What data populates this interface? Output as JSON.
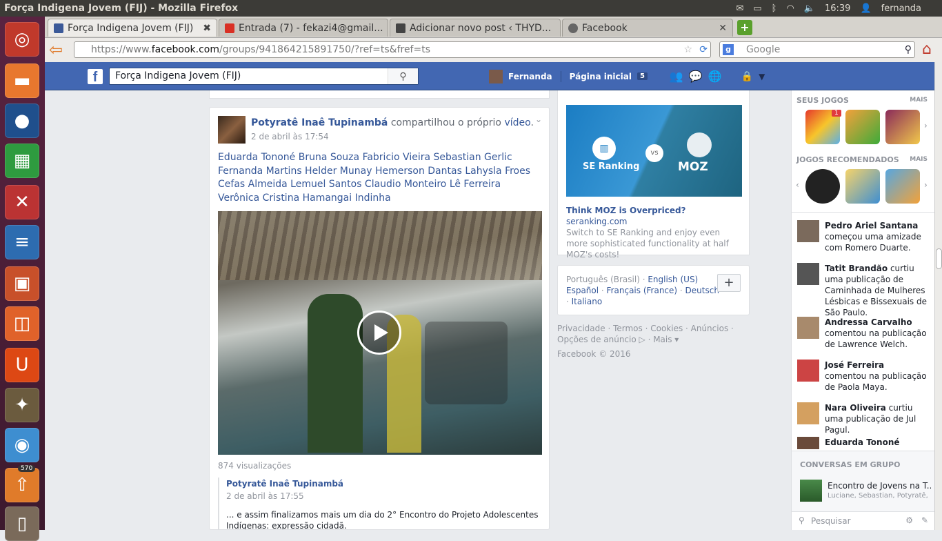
{
  "window_title": "Força Indigena Jovem (FIJ) - Mozilla Firefox",
  "sysbar": {
    "time": "16:39",
    "user": "fernanda"
  },
  "launcher": {
    "badge": "570"
  },
  "tabs": [
    {
      "label": "Força Indigena Jovem (FIJ)",
      "color": "#3b5998"
    },
    {
      "label": "Entrada (7) - fekazi4@gmail...",
      "color": "#d93025"
    },
    {
      "label": "Adicionar novo post ‹ THYD...",
      "color": "#444444"
    },
    {
      "label": "Facebook",
      "color": "#666666"
    }
  ],
  "url": {
    "prefix": "https://www.",
    "domain": "facebook.com",
    "path": "/groups/941864215891750/?ref=ts&fref=ts"
  },
  "google_search": {
    "placeholder": "Google"
  },
  "fbbar": {
    "search_value": "Força Indigena Jovem (FIJ)",
    "user_name": "Fernanda",
    "home": "Página inicial",
    "home_count": "5"
  },
  "post": {
    "author": "Potyratê Inaê Tupinambá",
    "action_pre": " compartilhou o próprio ",
    "action_link": "vídeo",
    "action_post": ".",
    "date": "2 de abril às 17:54",
    "tags": "Eduarda Tononé Bruna Souza Fabricio Vieira Sebastian Gerlic Fernanda Martins Helder Munay Hemerson Dantas Lahysla Froes Cefas Almeida Lemuel Santos Claudio Monteiro Lê Ferreira Verônica Cristina Hamangai Indinha",
    "views": "874 visualizações",
    "shared_author": "Potyratê Inaê Tupinambá",
    "shared_date": "2 de abril às 17:55",
    "shared_text": "... e assim finalizamos mais um dia do 2° Encontro do Projeto Adolescentes Indígenas: expressão cidadã."
  },
  "ad": {
    "left_brand": "SE Ranking",
    "vs": "vs",
    "right_brand": "MOZ",
    "title": "Think MOZ is Overpriced?",
    "domain": "seranking.com",
    "text": "Switch to SE Ranking and enjoy even more sophisticated functionality at half MOZ's costs!"
  },
  "languages": {
    "current": "Português (Brasil)",
    "l1": "English (US)",
    "l2": "Español",
    "l3": "Français (France)",
    "l4": "Deutsch",
    "l5": "Italiano",
    "sep": " · "
  },
  "footer": {
    "links": "Privacidade · Termos · Cookies · Anúncios · Opções de anúncio ▷ · Mais ▾",
    "copyright": "Facebook © 2016"
  },
  "sidebar": {
    "my_games": "SEUS JOGOS",
    "more": "MAIS",
    "rec_games": "JOGOS RECOMENDADOS",
    "game_badge": "1",
    "activity": [
      {
        "name": "Pedro Ariel Santana",
        "text": " começou uma amizade com Romero Duarte."
      },
      {
        "name": "Tatit Brandão",
        "text": " curtiu uma publicação de Caminhada de Mulheres Lésbicas e Bissexuais de São Paulo."
      },
      {
        "name": "Andressa Carvalho",
        "text": " comentou na publicação de Lawrence Welch."
      },
      {
        "name": "José Ferreira",
        "text": " comentou na publicação de Paola Maya."
      },
      {
        "name": "Nara Oliveira",
        "text": " curtiu uma publicação de Jul Pagul."
      },
      {
        "name": "Eduarda Tononé",
        "text": ""
      }
    ],
    "group_chats": "CONVERSAS EM GRUPO",
    "chat_title": "Encontro de Jovens na T...",
    "chat_members": "Luciane, Sebastian, Potyratê, ...",
    "search_placeholder": "Pesquisar"
  }
}
